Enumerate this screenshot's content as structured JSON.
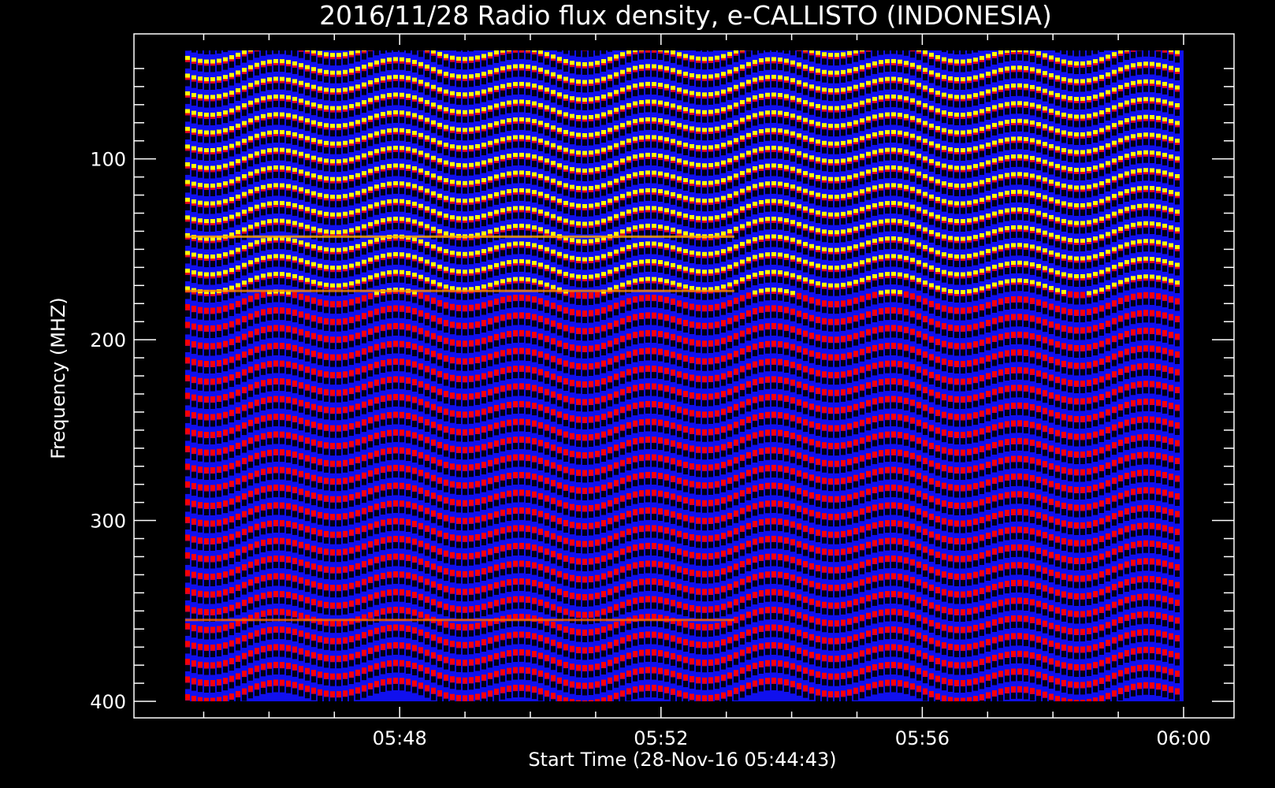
{
  "chart_data": {
    "type": "heatmap",
    "title": "2016/11/28  Radio flux density, e-CALLISTO (INDONESIA)",
    "xlabel": "Start Time (28-Nov-16 05:44:43)",
    "ylabel": "Frequency (MHZ)",
    "x_start": "05:44:43",
    "x_end": "06:00:00",
    "xlim": [
      "05:44:43",
      "06:00:00"
    ],
    "ylim": [
      400,
      40
    ],
    "y_inverted": true,
    "x_ticks": [
      "05:48",
      "05:52",
      "05:56",
      "06:00"
    ],
    "y_ticks": [
      100,
      200,
      300,
      400
    ],
    "colormap": [
      "#000000",
      "#0000ff",
      "#ff0000",
      "#ffff00"
    ],
    "notes": "Dynamic spectrum: regular striping of bright (red/yellow) and dark bands across frequency, with broader blue-dominant time columns near 05:50, 05:52 and 05:55."
  }
}
